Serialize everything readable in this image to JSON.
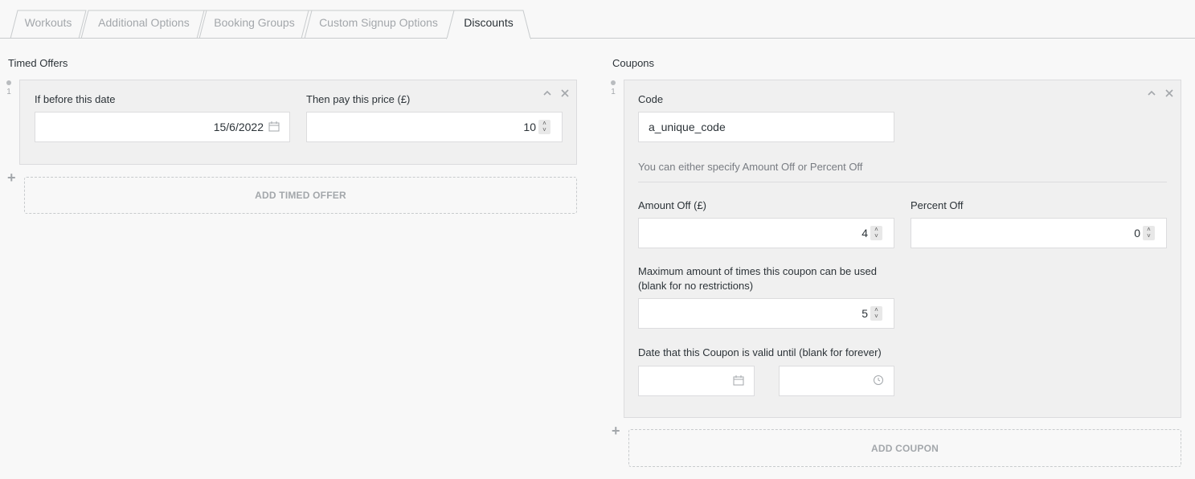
{
  "tabs": [
    {
      "label": "Workouts"
    },
    {
      "label": "Additional Options"
    },
    {
      "label": "Booking Groups"
    },
    {
      "label": "Custom Signup Options"
    },
    {
      "label": "Discounts"
    }
  ],
  "timed_offers": {
    "title": "Timed Offers",
    "items": [
      {
        "index": "1",
        "date_label": "If before this date",
        "date_value": "15/6/2022",
        "price_label": "Then pay this price (£)",
        "price_value": "10"
      }
    ],
    "add_label": "ADD TIMED OFFER"
  },
  "coupons": {
    "title": "Coupons",
    "items": [
      {
        "index": "1",
        "code_label": "Code",
        "code_value": "a_unique_code",
        "hint": "You can either specify Amount Off or Percent Off",
        "amount_label": "Amount Off (£)",
        "amount_value": "4",
        "percent_label": "Percent Off",
        "percent_value": "0",
        "max_label_line1": "Maximum amount of times this coupon can be used",
        "max_label_line2": "(blank for no restrictions)",
        "max_value": "5",
        "valid_label": "Date that this Coupon is valid until (blank for forever)"
      }
    ],
    "add_label": "ADD COUPON"
  },
  "controls": {
    "move_up": "^",
    "remove": "×"
  }
}
